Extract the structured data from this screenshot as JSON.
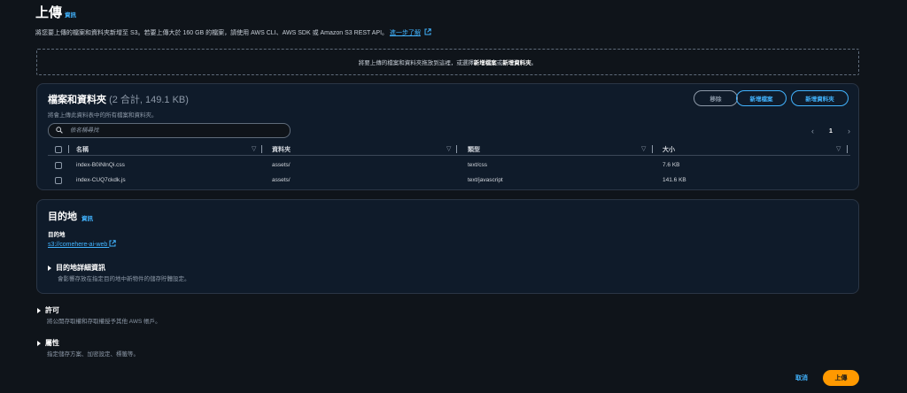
{
  "header": {
    "title": "上傳",
    "info": "資訊",
    "description": "將您要上傳的檔案和資料夾新增至 S3。若要上傳大於 160 GB 的檔案，請使用 AWS CLI、AWS SDK 或 Amazon S3 REST API。",
    "learn_more": "進一步了解"
  },
  "dropzone": {
    "text_before": "將要上傳的檔案和資料夾拖放到這裡，或選擇",
    "add_files": "新增檔案",
    "or": "或",
    "add_folder": "新增資料夾",
    "end": "。"
  },
  "files_panel": {
    "title": "檔案和資料夾",
    "count": "(2 合計, 149.1 KB)",
    "subtitle": "將會上傳此資料表中的所有檔案和資料夾。",
    "remove_button": "移除",
    "add_files_button": "新增檔案",
    "add_folder_button": "新增資料夾",
    "search_placeholder": "依名稱尋找",
    "page": "1",
    "columns": [
      "名稱",
      "資料夾",
      "類型",
      "大小"
    ],
    "rows": [
      {
        "name": "index-B0iNlnQi.css",
        "folder": "assets/",
        "type": "text/css",
        "size": "7.6 KB"
      },
      {
        "name": "index-CUQ7ckdk.js",
        "folder": "assets/",
        "type": "text/javascript",
        "size": "141.6 KB"
      }
    ]
  },
  "destination": {
    "title": "目的地",
    "info": "資訊",
    "label": "目的地",
    "link": "s3://comehere-ai-web",
    "details_title": "目的地詳細資訊",
    "details_sub": "會影響存放在指定目的地中新物件的儲存貯體設定。"
  },
  "permissions": {
    "title": "許可",
    "sub": "將公開存取權和存取權授予其他 AWS 帳戶。"
  },
  "properties": {
    "title": "屬性",
    "sub": "指定儲存方案、加密設定、標籤等。"
  },
  "footer": {
    "cancel": "取消",
    "upload": "上傳"
  }
}
